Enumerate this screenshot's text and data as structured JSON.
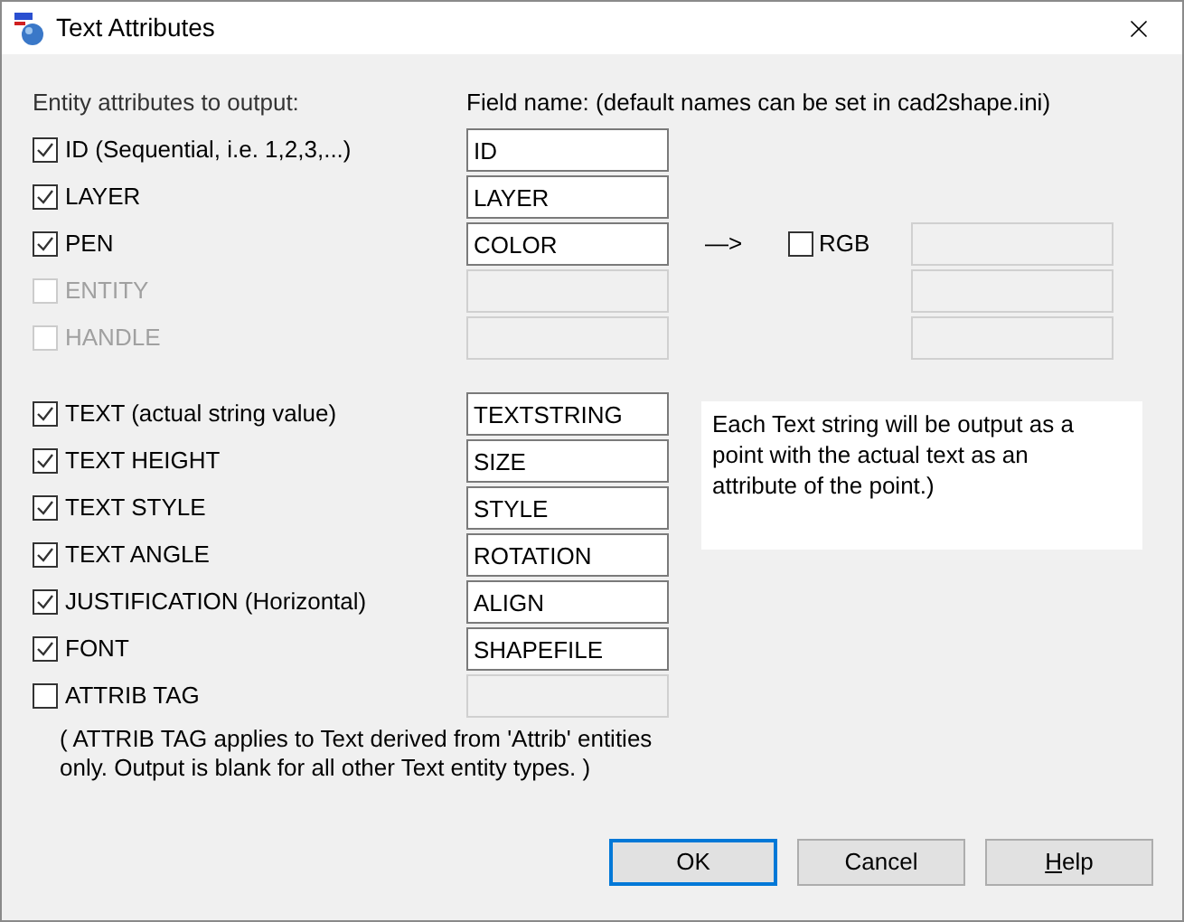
{
  "window": {
    "title": "Text Attributes"
  },
  "headings": {
    "entity": "Entity attributes to output:",
    "field": "Field name: (default names can be set in cad2shape.ini)"
  },
  "rows": [
    {
      "label": "ID (Sequential, i.e. 1,2,3,...)",
      "checked": true,
      "disabled": false,
      "field": "ID"
    },
    {
      "label": "LAYER",
      "checked": true,
      "disabled": false,
      "field": "LAYER"
    },
    {
      "label": "PEN",
      "checked": true,
      "disabled": false,
      "field": "COLOR"
    },
    {
      "label": "ENTITY",
      "checked": false,
      "disabled": true
    },
    {
      "label": "HANDLE",
      "checked": false,
      "disabled": true
    }
  ],
  "rgb": {
    "arrow": "—>",
    "label": "RGB",
    "checked": false,
    "fields": [
      {
        "disabled": true
      },
      {
        "disabled": true
      },
      {
        "disabled": true
      }
    ]
  },
  "text_rows": [
    {
      "label": "TEXT (actual string value)",
      "checked": true,
      "disabled": false,
      "field": "TEXTSTRING"
    },
    {
      "label": "TEXT HEIGHT",
      "checked": true,
      "disabled": false,
      "field": "SIZE"
    },
    {
      "label": "TEXT STYLE",
      "checked": true,
      "disabled": false,
      "field": "STYLE"
    },
    {
      "label": "TEXT ANGLE",
      "checked": true,
      "disabled": false,
      "field": "ROTATION"
    },
    {
      "label": "JUSTIFICATION (Horizontal)",
      "checked": true,
      "disabled": false,
      "field": "ALIGN"
    },
    {
      "label": "FONT",
      "checked": true,
      "disabled": false,
      "field": "SHAPEFILE"
    },
    {
      "label": "ATTRIB TAG",
      "checked": false,
      "disabled": false,
      "field_disabled": true
    }
  ],
  "info": "Each Text string will be output as a point with the actual text as an attribute of the point.)",
  "note": "( ATTRIB TAG applies to Text derived from 'Attrib' entities\nonly.  Output is blank for all other Text entity types. )",
  "buttons": [
    {
      "label": "OK",
      "default": true,
      "underline_first": false
    },
    {
      "label": "Cancel",
      "default": false,
      "underline_first": false
    },
    {
      "label": "Help",
      "default": false,
      "underline_first": true
    }
  ]
}
